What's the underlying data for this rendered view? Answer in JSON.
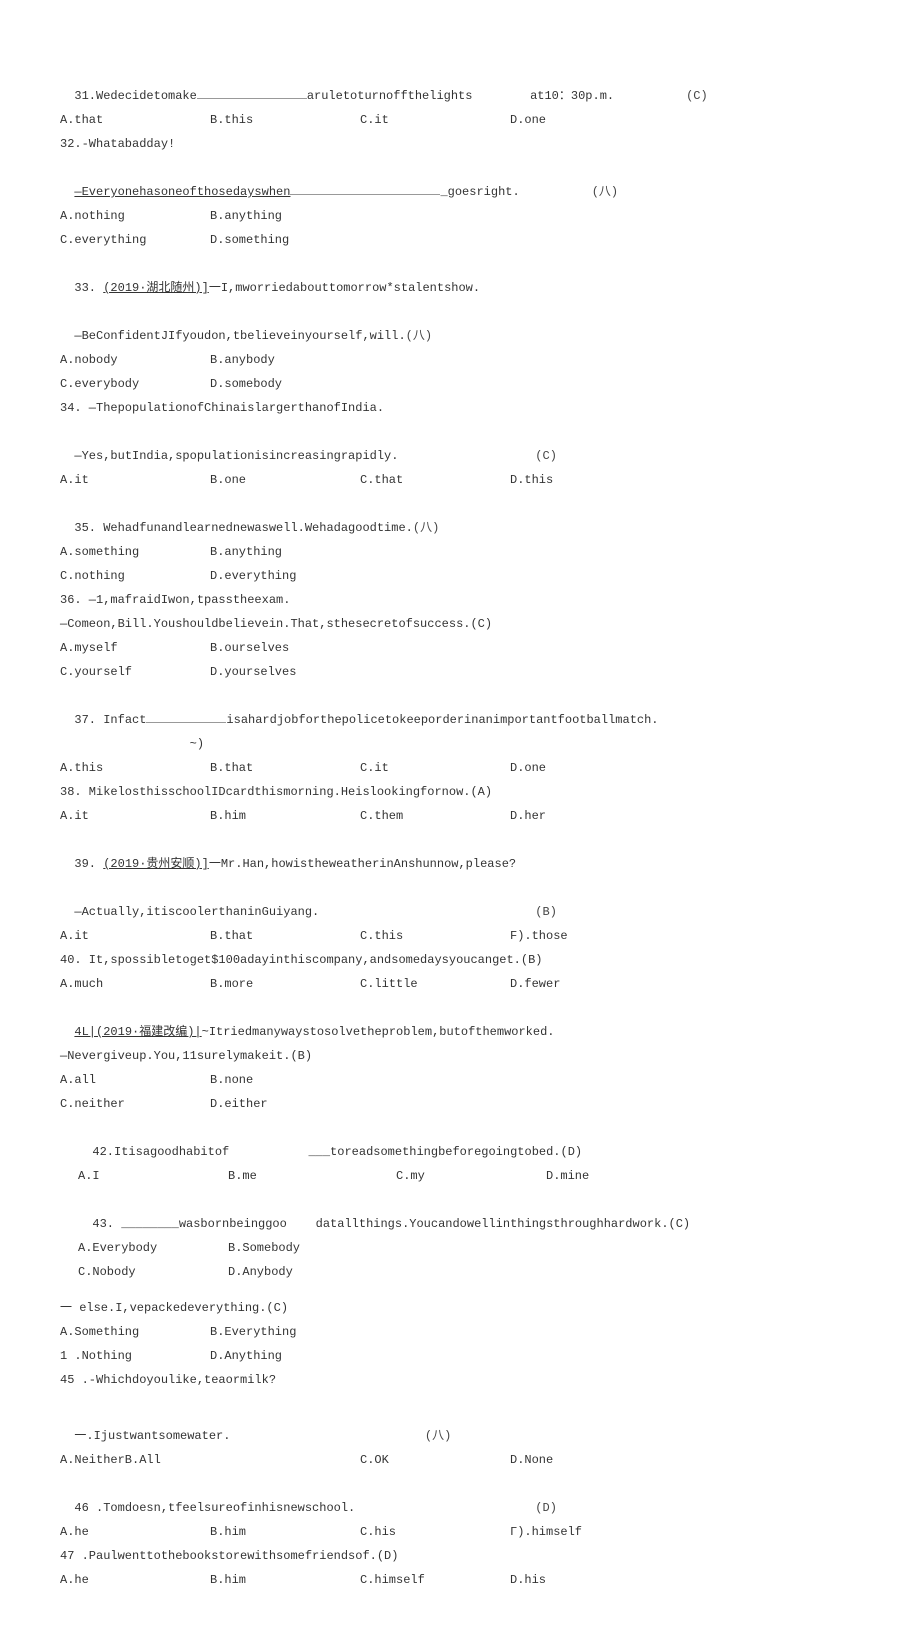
{
  "q31": {
    "num": "31.Wedecidetomake",
    "rest": "aruletoturnoffthelights",
    "time": "at10：30p.m.",
    "ans": "(C)",
    "a": "A.that",
    "b": "B.this",
    "c": "C.it",
    "d": "D.one"
  },
  "q32": {
    "l1": "32.-Whatabadday!",
    "l2a": "—Everyonehasoneofthosedayswhen",
    "l2b": "_goesright.",
    "ans": "(八)",
    "a": "A.nothing",
    "b": "B.anything",
    "c": "C.everything",
    "d": "D.something"
  },
  "q33": {
    "l1a": "33.",
    "l1b": "(2019·湖北随州)]",
    "l1c": "一I,mworriedabouttomorrow*stalentshow.",
    "l2": "—BeConfidentJIfyoudon,tbelieveinyourself,will.",
    "ans": "(八)",
    "a": "A.nobody",
    "b": "B.anybody",
    "c": "C.everybody",
    "d": "D.somebody"
  },
  "q34": {
    "l1": "34. —ThepopulationofChinaislargerthanofIndia.",
    "l2": "—Yes,butIndia,spopulationisincreasingrapidly.",
    "ans": "(C)",
    "a": "A.it",
    "b": "B.one",
    "c": "C.that",
    "d": "D.this"
  },
  "q35": {
    "l1": "35. Wehadfunandlearnednewaswell.Wehadagoodtime.",
    "ans": "(八)",
    "a": "A.something",
    "b": "B.anything",
    "c": "C.nothing",
    "d": "D.everything"
  },
  "q36": {
    "l1": "36. —1,mafraidIwon,tpasstheexam.",
    "l2": "—Comeon,Bill.Youshouldbelievein.That,sthesecretofsuccess.(C)",
    "a": "A.myself",
    "b": "B.ourselves",
    "c": "C.yourself",
    "d": "D.yourselves"
  },
  "q37": {
    "l1a": "37. Infact",
    "l1b": "isahardjobforthepolicetokeeporderinanimportantfootballmatch.",
    "mid": "~)",
    "a": "A.this",
    "b": "B.that",
    "c": "C.it",
    "d": "D.one"
  },
  "q38": {
    "l1": "38. MikelosthisschoolIDcardthismorning.Heislookingfornow.(A)",
    "a": "A.it",
    "b": "B.him",
    "c": "C.them",
    "d": "D.her"
  },
  "q39": {
    "l1a": "39.",
    "l1b": "(2019·贵州安顺)]",
    "l1c": "一Mr.Han,howistheweatherinAnshunnow,please?",
    "l2": "—Actually,itiscoolerthaninGuiyang.",
    "ans": "(B)",
    "a": "A.it",
    "b": "B.that",
    "c": "C.this",
    "d": "F).those"
  },
  "q40": {
    "l1": "40. It,spossibletoget$100adayinthiscompany,andsomedaysyoucanget.(B)",
    "a": "A.much",
    "b": "B.more",
    "c": "C.little",
    "d": "D.fewer"
  },
  "q41": {
    "l1a": "4L|(2019·福建改编)|",
    "l1b": "~Itriedmanywaystosolvetheproblem,butofthemworked.",
    "l2": "—Nevergiveup.You,11surelymakeit.(B)",
    "a": "A.all",
    "b": "B.none",
    "c": "C.neither",
    "d": "D.either"
  },
  "q42": {
    "l1a": "42.Itisagoodhabitof",
    "l1b": "___toreadsomethingbeforegoingtobed.(D)",
    "a": "A.I",
    "b": "B.me",
    "c": "C.my",
    "d": "D.mine"
  },
  "q43": {
    "l1a": "43. ________wasbornbeinggoo",
    "l1b": "datallthings.Youcandowellinthingsthroughhardwork.(C)",
    "a": "A.Everybody",
    "b": "B.Somebody",
    "c": "C.Nobody",
    "d": "D.Anybody"
  },
  "q44": {
    "l1": "一 else.I,vepackedeverything.(C)",
    "a": "A.Something",
    "b": "B.Everything",
    "c": "1 .Nothing",
    "d": "D.Anything"
  },
  "q45": {
    "l1": "45 .-Whichdoyoulike,teaormilk?",
    "l2": "一.Ijustwantsomewater.",
    "ans": "(八)",
    "a": "A.NeitherB.All",
    "c": "C.OK",
    "d": "D.None"
  },
  "q46": {
    "l1": "46 .Tomdoesn,tfeelsureofinhisnewschool.",
    "ans": "(D)",
    "a": "A.he",
    "b": "B.him",
    "c": "C.his",
    "d": "Г).himself"
  },
  "q47": {
    "l1": "47 .Paulwenttothebookstorewithsomefriendsof.(D)",
    "a": "A.he",
    "b": "B.him",
    "c": "C.himself",
    "d": "D.his"
  }
}
